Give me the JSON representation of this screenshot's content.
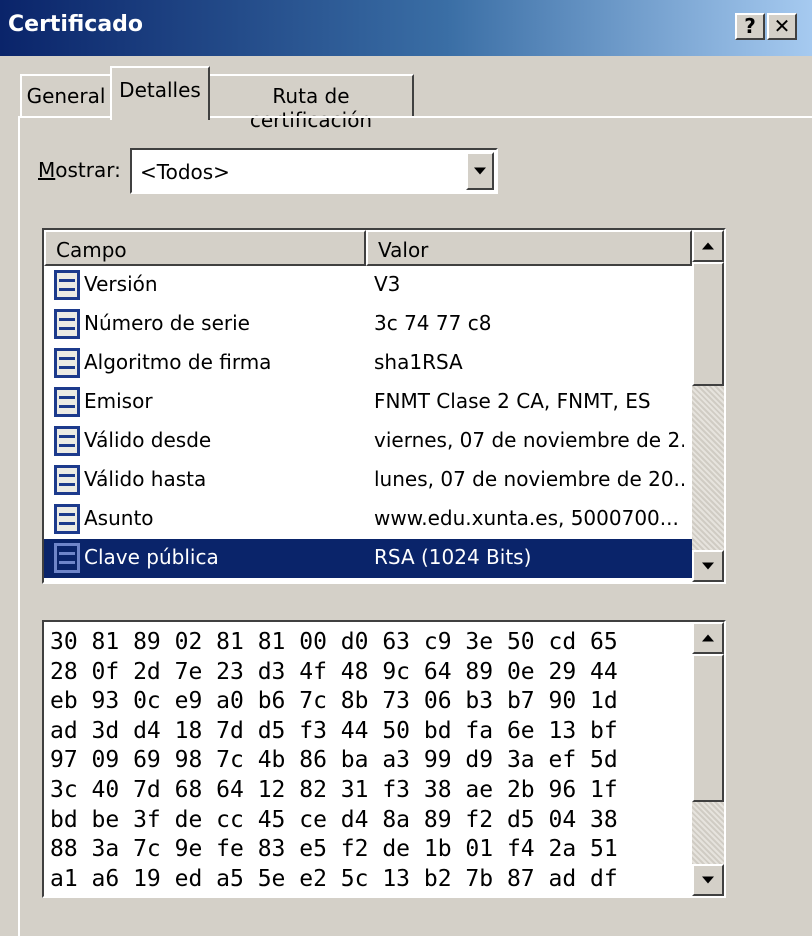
{
  "window": {
    "title": "Certificado",
    "help_label": "?",
    "close_label": "✕"
  },
  "tabs": [
    {
      "label": "General"
    },
    {
      "label": "Detalles"
    },
    {
      "label": "Ruta de certificación"
    }
  ],
  "mostrar": {
    "label_first": "M",
    "label_rest": "ostrar:",
    "value": "<Todos>"
  },
  "list": {
    "headers": {
      "campo": "Campo",
      "valor": "Valor"
    },
    "rows": [
      {
        "field": "Versión",
        "value": "V3"
      },
      {
        "field": "Número de serie",
        "value": "3c 74 77 c8"
      },
      {
        "field": "Algoritmo de firma",
        "value": "sha1RSA"
      },
      {
        "field": "Emisor",
        "value": "FNMT Clase 2 CA, FNMT, ES"
      },
      {
        "field": "Válido desde",
        "value": "viernes, 07 de noviembre de 2..."
      },
      {
        "field": "Válido hasta",
        "value": "lunes, 07 de noviembre de 20..."
      },
      {
        "field": "Asunto",
        "value": "www.edu.xunta.es, 5000700..."
      },
      {
        "field": "Clave pública",
        "value": "RSA (1024 Bits)"
      }
    ],
    "selected_index": 7
  },
  "hex": {
    "lines": [
      "30 81 89 02 81 81 00 d0 63 c9 3e 50 cd 65",
      "28 0f 2d 7e 23 d3 4f 48 9c 64 89 0e 29 44",
      "eb 93 0c e9 a0 b6 7c 8b 73 06 b3 b7 90 1d",
      "ad 3d d4 18 7d d5 f3 44 50 bd fa 6e 13 bf",
      "97 09 69 98 7c 4b 86 ba a3 99 d9 3a ef 5d",
      "3c 40 7d 68 64 12 82 31 f3 38 ae 2b 96 1f",
      "bd be 3f de cc 45 ce d4 8a 89 f2 d5 04 38",
      "88 3a 7c 9e fe 83 e5 f2 de 1b 01 f4 2a 51",
      "a1 a6 19 ed a5 5e e2 5c 13 b2 7b 87 ad df"
    ]
  }
}
